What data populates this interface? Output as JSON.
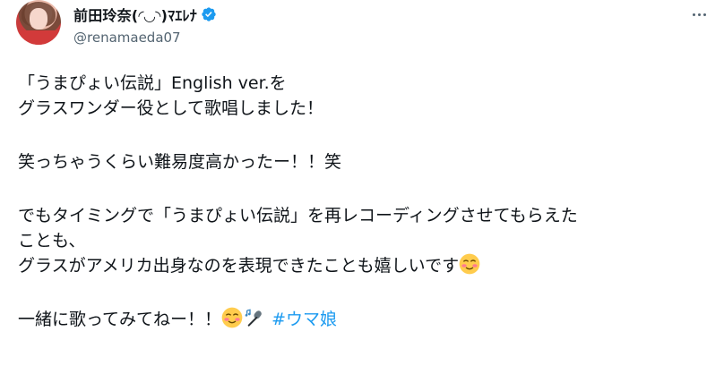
{
  "author": {
    "display_name": "前田玲奈(◜◡◝)ﾏｴﾚﾅ",
    "handle": "@renamaeda07",
    "verified_icon": "verified-badge-icon",
    "badge_color": "#1d9bf0"
  },
  "tweet": {
    "lines": [
      "「うまぴょい伝説」English ver.を",
      "グラスワンダー役として歌唱しました！",
      "",
      "笑っちゃうくらい難易度高かったー！！笑",
      "",
      "でもタイミングで「うまぴょい伝説」を再レコーディングさせてもらえた",
      "ことも、",
      "グラスがアメリカ出身なのを表現できたことも嬉しいです",
      "",
      "一緒に歌ってみてねー！！"
    ],
    "hashtag": "#ウマ娘",
    "emojis": [
      "smiling-blush-emoji",
      "microphone-music-emoji"
    ]
  },
  "colors": {
    "text": "#0f1419",
    "secondary": "#536471",
    "link": "#1d9bf0"
  }
}
